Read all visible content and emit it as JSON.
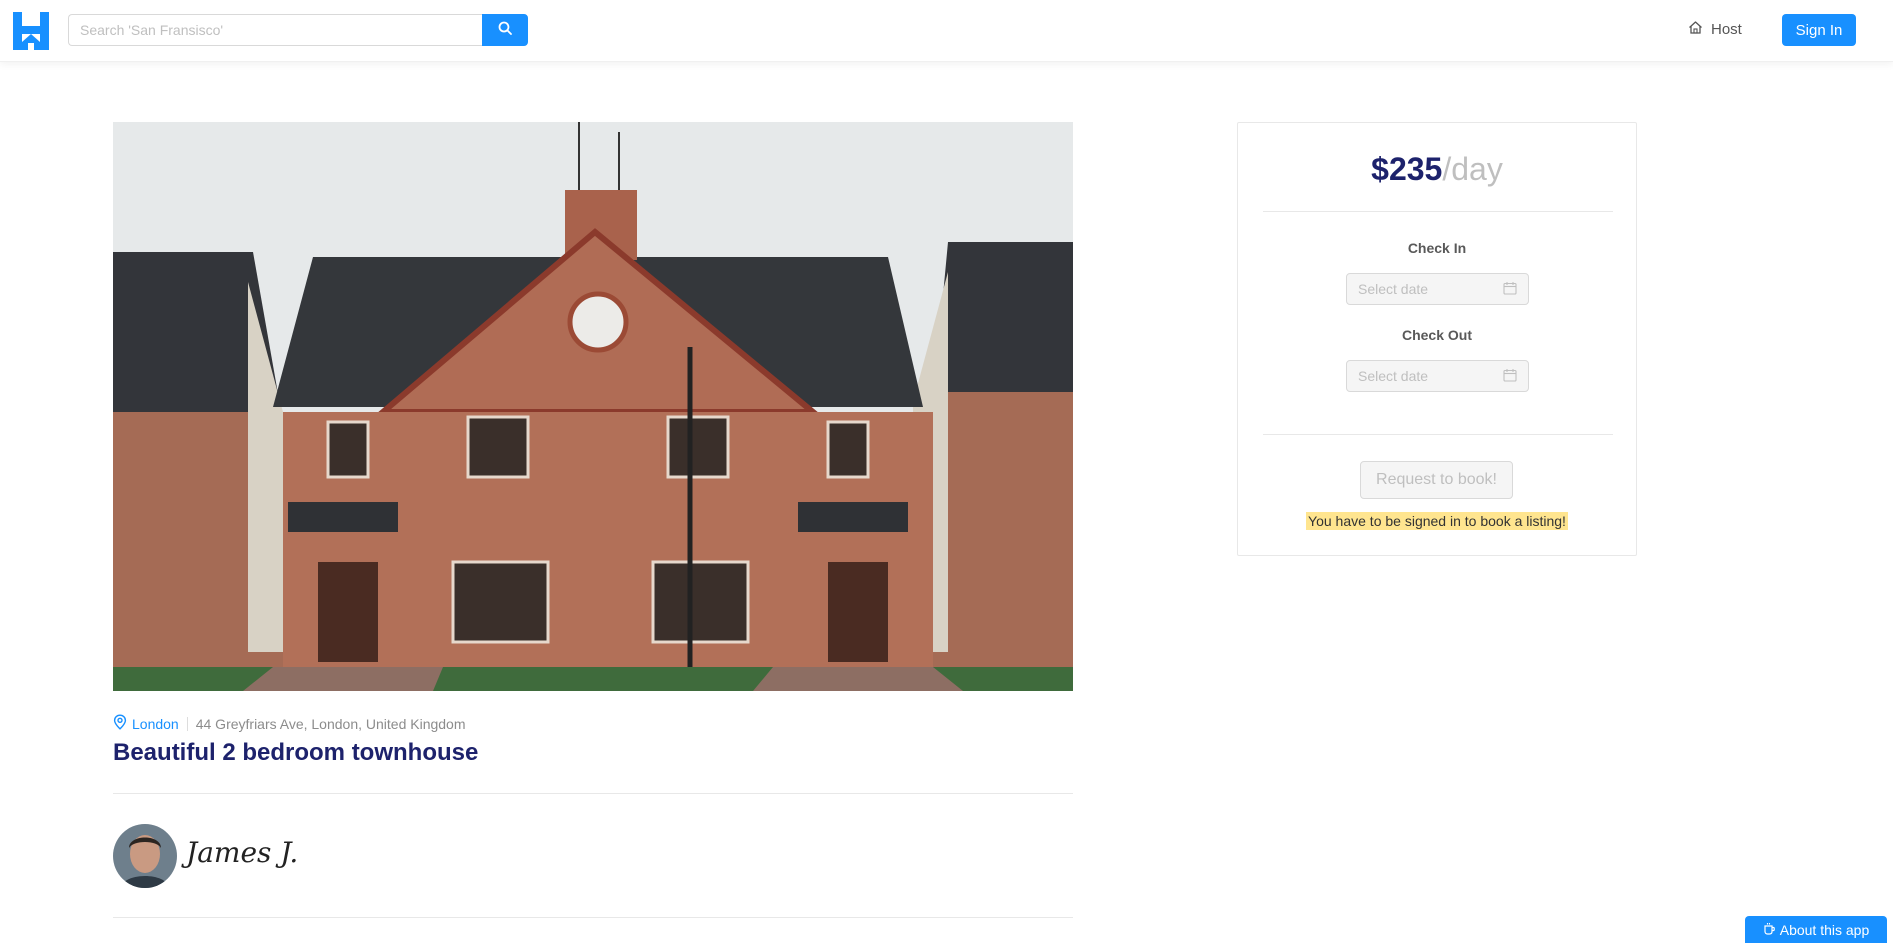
{
  "header": {
    "search_placeholder": "Search 'San Fransisco'",
    "host_label": "Host",
    "signin_label": "Sign In"
  },
  "listing": {
    "city": "London",
    "address": "44 Greyfriars Ave, London, United Kingdom",
    "title": "Beautiful 2 bedroom townhouse",
    "host_name": "James J."
  },
  "booking": {
    "price": "$235",
    "price_unit": "/day",
    "check_in_label": "Check In",
    "check_out_label": "Check Out",
    "date_placeholder": "Select date",
    "request_label": "Request to book!",
    "signin_notice": "You have to be signed in to book a listing!"
  },
  "about_label": "About this app",
  "colors": {
    "primary": "#1890ff",
    "title": "#1d226c",
    "notice_bg": "#ffe58f"
  },
  "icons": [
    "logo-icon",
    "search-icon",
    "home-icon",
    "location-pin-icon",
    "calendar-icon",
    "coffee-icon"
  ]
}
